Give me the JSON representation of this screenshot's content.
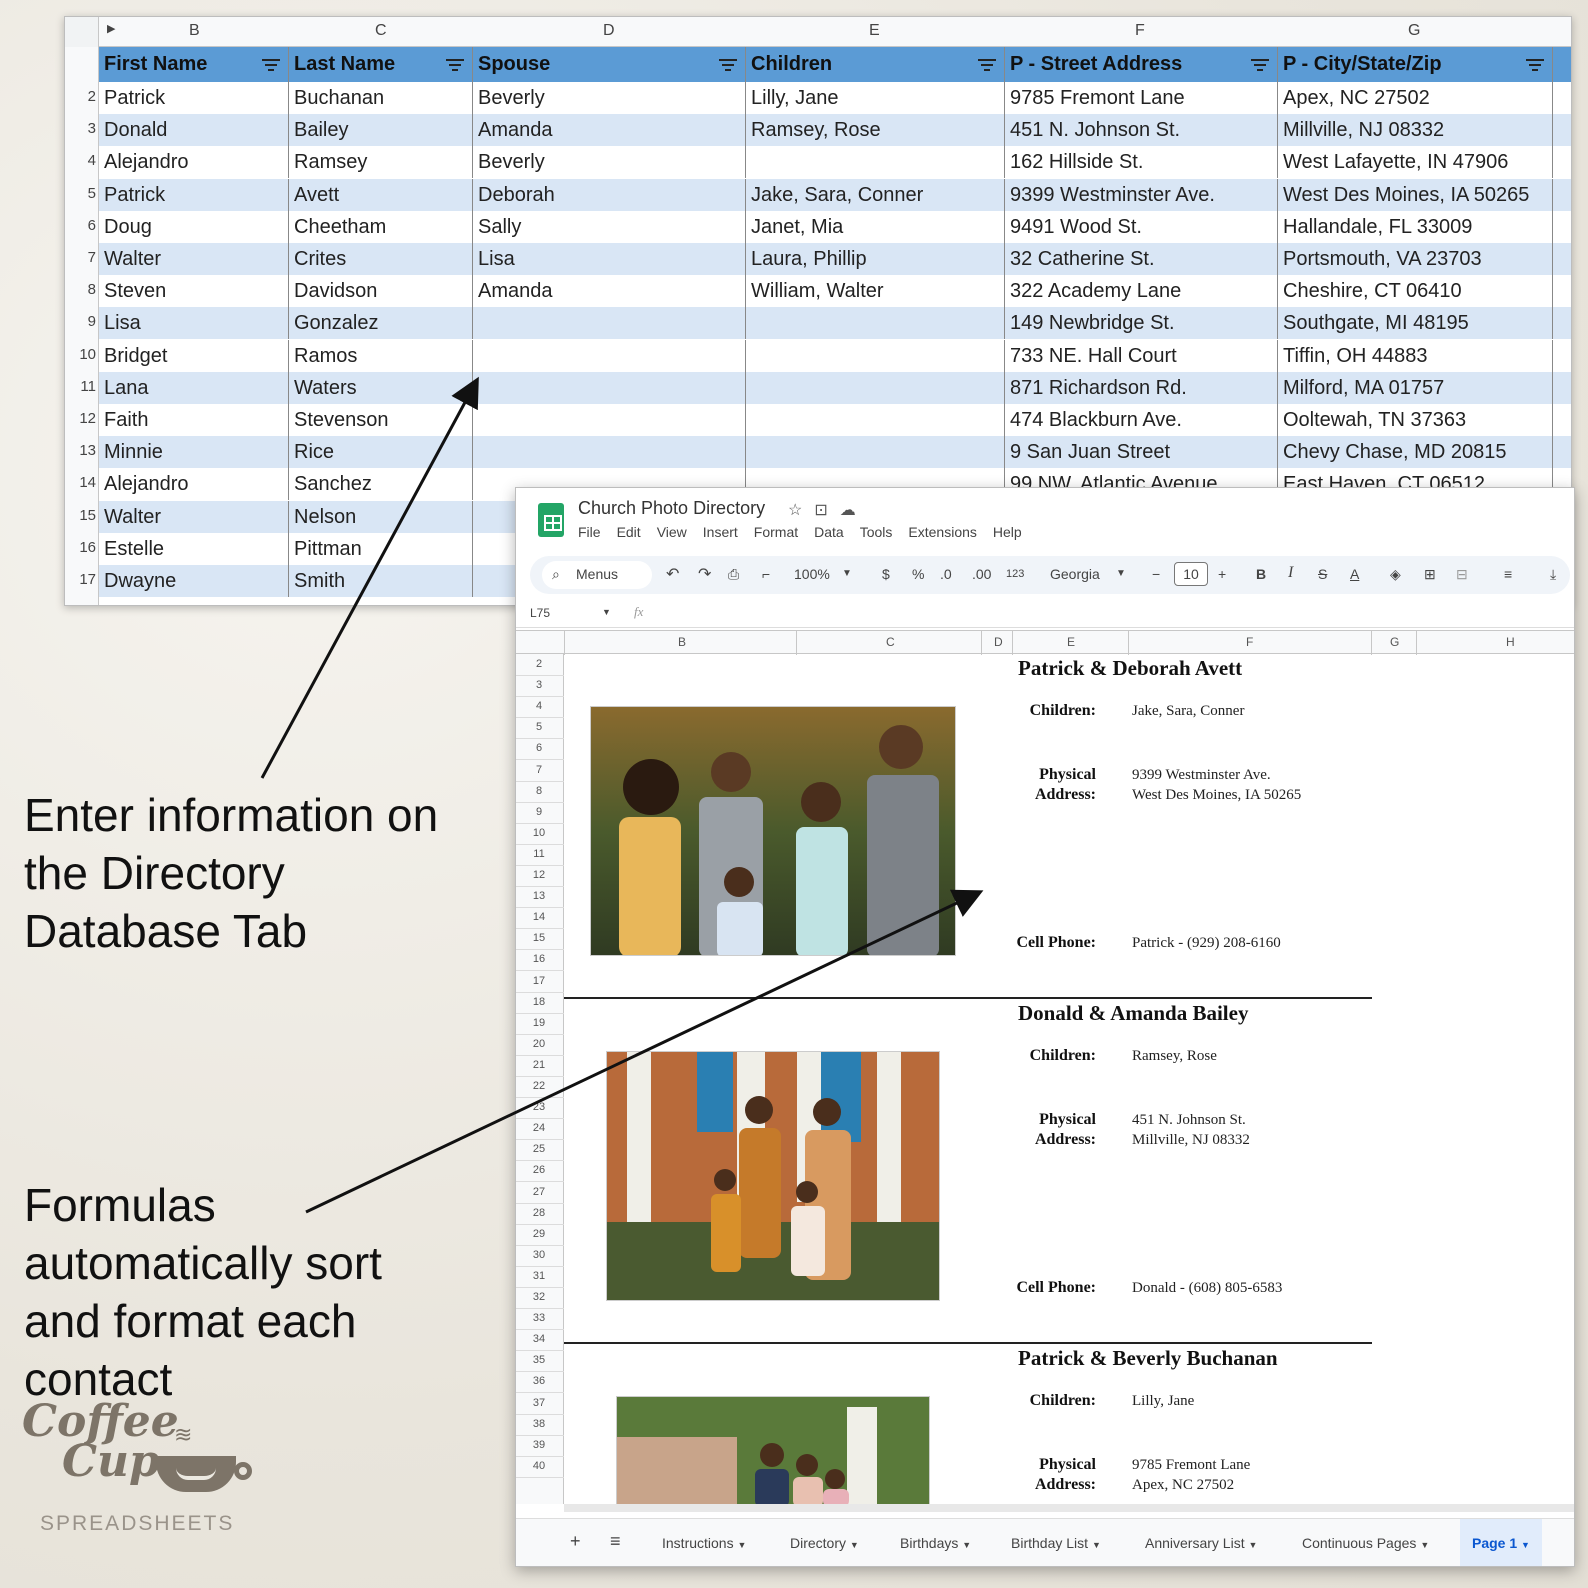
{
  "database_sheet": {
    "col_letters": [
      "B",
      "C",
      "D",
      "E",
      "F",
      "G"
    ],
    "headers": [
      "First Name",
      "Last Name",
      "Spouse",
      "Children",
      "P - Street Address",
      "P - City/State/Zip"
    ],
    "row_numbers": [
      "2",
      "3",
      "4",
      "5",
      "6",
      "7",
      "8",
      "9",
      "10",
      "11",
      "12",
      "13",
      "14",
      "15",
      "16",
      "17"
    ],
    "rows": [
      [
        "Patrick",
        "Buchanan",
        "Beverly",
        "Lilly, Jane",
        "9785 Fremont Lane",
        "Apex, NC 27502"
      ],
      [
        "Donald",
        "Bailey",
        "Amanda",
        "Ramsey, Rose",
        "451 N. Johnson St.",
        "Millville, NJ 08332"
      ],
      [
        "Alejandro",
        "Ramsey",
        "Beverly",
        "",
        "162 Hillside St.",
        "West Lafayette, IN 47906"
      ],
      [
        "Patrick",
        "Avett",
        "Deborah",
        "Jake, Sara, Conner",
        "9399 Westminster Ave.",
        "West Des Moines, IA 50265"
      ],
      [
        "Doug",
        "Cheetham",
        "Sally",
        "Janet, Mia",
        "9491 Wood St.",
        "Hallandale, FL 33009"
      ],
      [
        "Walter",
        "Crites",
        "Lisa",
        "Laura, Phillip",
        "32 Catherine St.",
        "Portsmouth, VA 23703"
      ],
      [
        "Steven",
        "Davidson",
        "Amanda",
        "William, Walter",
        "322 Academy Lane",
        "Cheshire, CT 06410"
      ],
      [
        "Lisa",
        "Gonzalez",
        "",
        "",
        "149 Newbridge St.",
        "Southgate, MI 48195"
      ],
      [
        "Bridget",
        "Ramos",
        "",
        "",
        "733 NE. Hall Court",
        "Tiffin, OH 44883"
      ],
      [
        "Lana",
        "Waters",
        "",
        "",
        "871 Richardson Rd.",
        "Milford, MA 01757"
      ],
      [
        "Faith",
        "Stevenson",
        "",
        "",
        "474 Blackburn Ave.",
        "Ooltewah, TN 37363"
      ],
      [
        "Minnie",
        "Rice",
        "",
        "",
        "9 San Juan Street",
        "Chevy Chase, MD 20815"
      ],
      [
        "Alejandro",
        "Sanchez",
        "",
        "",
        "99 NW. Atlantic Avenue",
        "East Haven, CT 06512"
      ],
      [
        "Walter",
        "Nelson",
        "",
        "",
        "",
        ""
      ],
      [
        "Estelle",
        "Pittman",
        "",
        "",
        "",
        ""
      ],
      [
        "Dwayne",
        "Smith",
        "",
        "",
        "",
        ""
      ]
    ]
  },
  "app": {
    "doc_title": "Church Photo Directory",
    "menu": [
      "File",
      "Edit",
      "View",
      "Insert",
      "Format",
      "Data",
      "Tools",
      "Extensions",
      "Help"
    ],
    "search_label": "Menus",
    "zoom": "100%",
    "currency": "$",
    "percent": "%",
    "dec_less": ".0",
    "dec_more": ".00",
    "num_format": "123",
    "font": "Georgia",
    "font_size": "10",
    "cell_ref": "L75",
    "fx": "fx",
    "col_letters": [
      "B",
      "C",
      "D",
      "E",
      "F",
      "G",
      "H"
    ],
    "row_numbers": [
      "2",
      "3",
      "4",
      "5",
      "6",
      "7",
      "8",
      "9",
      "10",
      "11",
      "12",
      "13",
      "14",
      "15",
      "16",
      "17",
      "18",
      "19",
      "20",
      "21",
      "22",
      "23",
      "24",
      "25",
      "26",
      "27",
      "28",
      "29",
      "30",
      "31",
      "32",
      "33",
      "34",
      "35",
      "36",
      "37",
      "38",
      "39",
      "40"
    ]
  },
  "labels": {
    "children": "Children:",
    "physical": "Physical",
    "address": "Address:",
    "cell_phone": "Cell Phone:"
  },
  "cards": [
    {
      "name": "Patrick & Deborah Avett",
      "children": "Jake, Sara, Conner",
      "street": "9399 Westminster Ave.",
      "city": "West Des Moines, IA 50265",
      "phone": "Patrick - (929) 208-6160"
    },
    {
      "name": "Donald & Amanda Bailey",
      "children": "Ramsey, Rose",
      "street": "451 N. Johnson St.",
      "city": "Millville, NJ 08332",
      "phone": "Donald - (608) 805-6583"
    },
    {
      "name": "Patrick & Beverly Buchanan",
      "children": "Lilly, Jane",
      "street": "9785 Fremont Lane",
      "city": "Apex, NC 27502",
      "phone": ""
    }
  ],
  "tabs": [
    "Instructions",
    "Directory",
    "Birthdays",
    "Birthday List",
    "Anniversary List",
    "Continuous Pages",
    "Page 1"
  ],
  "annotations": {
    "top": [
      "Enter information on",
      "the Directory",
      "Database Tab"
    ],
    "bottom": [
      "Formulas",
      "automatically sort",
      "and format each",
      "contact"
    ]
  },
  "logo": {
    "line1": "Coffee",
    "line2": "Cup",
    "line3": "SPREADSHEETS"
  },
  "colors": {
    "header_blue": "#5b9bd5",
    "alt_row": "#d9e6f5",
    "sheets_green": "#23a566",
    "active_tab": "#0b57d0"
  }
}
